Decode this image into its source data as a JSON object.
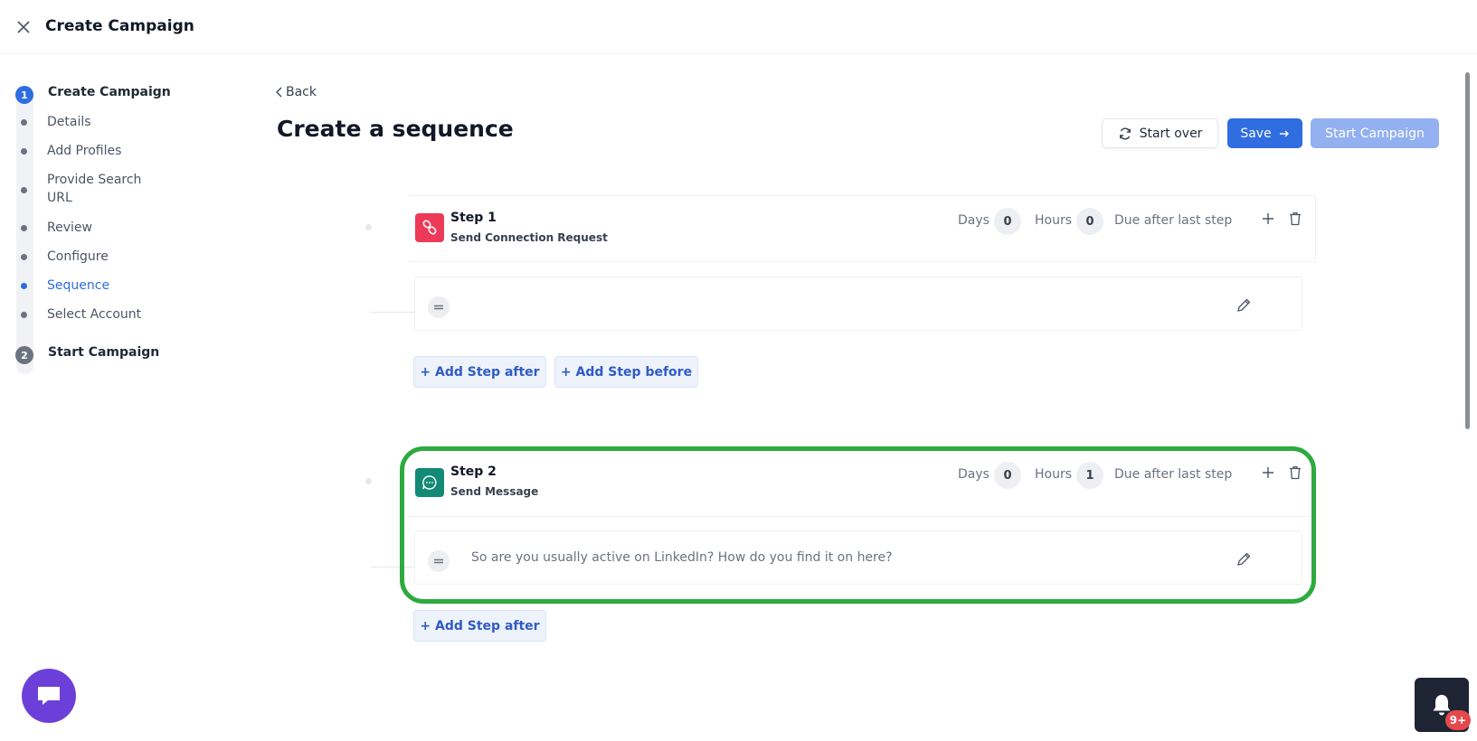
{
  "header": {
    "title": "Create Campaign"
  },
  "stepper": {
    "step1": {
      "number": "1",
      "label": "Create Campaign"
    },
    "substeps": [
      {
        "label": "Details"
      },
      {
        "label": "Add Profiles"
      },
      {
        "label": "Provide Search URL"
      },
      {
        "label": "Review"
      },
      {
        "label": "Configure"
      },
      {
        "label": "Sequence",
        "active": true
      },
      {
        "label": "Select Account"
      }
    ],
    "step2": {
      "number": "2",
      "label": "Start Campaign"
    }
  },
  "page": {
    "back_label": "Back",
    "title": "Create a sequence",
    "start_over_label": "Start over",
    "save_label": "Save",
    "start_campaign_label": "Start Campaign"
  },
  "steps": [
    {
      "title": "Step 1",
      "subtitle": "Send Connection Request",
      "icon": "link-icon",
      "icon_color": "#ee3a59",
      "days_label": "Days",
      "days": "0",
      "hours_label": "Hours",
      "hours": "0",
      "due_label": "Due after last step",
      "message": "",
      "add_after_label": "+ Add Step after",
      "add_before_label": "+ Add Step before"
    },
    {
      "title": "Step 2",
      "subtitle": "Send Message",
      "icon": "message-icon",
      "icon_color": "#128a75",
      "days_label": "Days",
      "days": "0",
      "hours_label": "Hours",
      "hours": "1",
      "due_label": "Due after last step",
      "message": "So are you usually active on LinkedIn? How do you find it on here?",
      "add_after_label": "+ Add Step after"
    }
  ],
  "notifications": {
    "badge": "9+"
  },
  "colors": {
    "accent": "#2f6de1",
    "highlight": "#2eaa3f",
    "chat": "#6d3fd9"
  }
}
